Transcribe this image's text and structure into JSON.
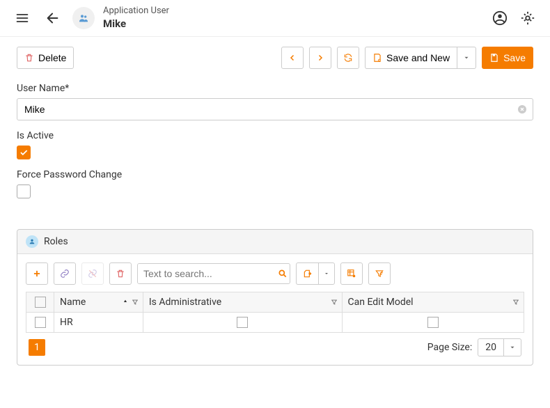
{
  "colors": {
    "accent": "#f57c00"
  },
  "header": {
    "type_label": "Application User",
    "title": "Mike"
  },
  "toolbar": {
    "delete_label": "Delete",
    "save_and_new_label": "Save and New",
    "save_label": "Save"
  },
  "form": {
    "user_name_label": "User Name*",
    "user_name_value": "Mike",
    "is_active_label": "Is Active",
    "is_active_checked": true,
    "force_pw_label": "Force Password Change",
    "force_pw_checked": false
  },
  "roles": {
    "title": "Roles",
    "search_placeholder": "Text to search...",
    "columns": {
      "name": "Name",
      "is_admin": "Is Administrative",
      "can_edit": "Can Edit Model"
    },
    "rows": [
      {
        "name": "HR",
        "is_admin": false,
        "can_edit": false
      }
    ],
    "pager": {
      "current": "1",
      "size_label": "Page Size:",
      "size": "20"
    }
  }
}
